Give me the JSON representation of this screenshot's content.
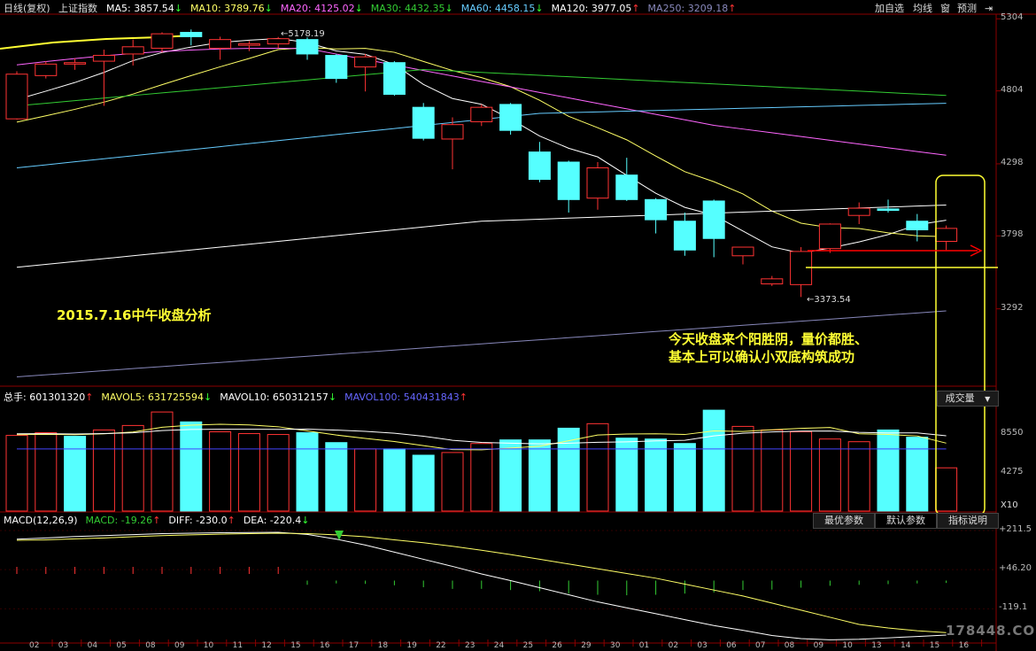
{
  "header": {
    "period": "日线(复权)",
    "index_name": "上证指数",
    "ma": [
      {
        "label": "MA5: 3857.54",
        "arrow": "↓",
        "color": "#ffffff"
      },
      {
        "label": "MA10: 3789.76",
        "arrow": "↓",
        "color": "#ffff66"
      },
      {
        "label": "MA20: 4125.02",
        "arrow": "↓",
        "color": "#ff66ff"
      },
      {
        "label": "MA30: 4432.35",
        "arrow": "↓",
        "color": "#33cc33"
      },
      {
        "label": "MA60: 4458.15",
        "arrow": "↓",
        "color": "#66ccff"
      },
      {
        "label": "MA120: 3977.05",
        "arrow": "↑",
        "color": "#ffffff"
      },
      {
        "label": "MA250: 3209.18",
        "arrow": "↑",
        "color": "#8888bb"
      }
    ],
    "buttons": [
      "加自选",
      "均线",
      "窗",
      "预测"
    ],
    "collapse_icon": "collapse-right-icon"
  },
  "volume_header": {
    "items": [
      {
        "label": "总手: 601301320",
        "arrow": "↑",
        "color": "#ffffff"
      },
      {
        "label": "MAVOL5: 631725594",
        "arrow": "↓",
        "color": "#ffff66"
      },
      {
        "label": "MAVOL10: 650312157",
        "arrow": "↓",
        "color": "#ffffff"
      },
      {
        "label": "MAVOL100: 540431843",
        "arrow": "↑",
        "color": "#6666ff"
      }
    ],
    "select_label": "成交量"
  },
  "macd_header": {
    "items": [
      {
        "label": "MACD(12,26,9)",
        "arrow": "",
        "color": "#ffffff"
      },
      {
        "label": "MACD: -19.26",
        "arrow": "↑",
        "color": "#33cc33"
      },
      {
        "label": "DIFF: -230.0",
        "arrow": "↑",
        "color": "#ffffff"
      },
      {
        "label": "DEA: -220.4",
        "arrow": "↓",
        "color": "#ffffff"
      }
    ],
    "tabs": [
      "最优参数",
      "默认参数",
      "指标说明"
    ]
  },
  "annotations": {
    "date_title": "2015.7.16中午收盘分析",
    "comment_line1": "今天收盘来个阳胜阴，量价都胜、",
    "comment_line2": "基本上可以确认小双底构筑成功",
    "high_label": "←5178.19",
    "low_label": "←3373.54",
    "volume_unit": "X10",
    "watermark": "178448.COM"
  },
  "colors": {
    "up": "#ff3333",
    "down": "#55ffff",
    "highlight": "#ffff33",
    "arrow": "#ff0000"
  },
  "chart_data": {
    "type": "candlestick",
    "title": "上证指数 日线(复权)",
    "price_axis_ticks": [
      5304,
      4804,
      4298,
      3798,
      3292
    ],
    "price_range": [
      2780,
      5330
    ],
    "x_ticks": [
      "02",
      "03",
      "04",
      "05",
      "08",
      "09",
      "10",
      "11",
      "12",
      "15",
      "16",
      "17",
      "18",
      "19",
      "22",
      "23",
      "24",
      "25",
      "26",
      "29",
      "30",
      "01",
      "02",
      "03",
      "06",
      "07",
      "08",
      "09",
      "10",
      "13",
      "14",
      "15",
      "16"
    ],
    "candles": [
      {
        "o": 4610,
        "c": 4920,
        "h": 4940,
        "l": 4605
      },
      {
        "o": 4910,
        "c": 4990,
        "h": 5010,
        "l": 4890
      },
      {
        "o": 4990,
        "c": 5000,
        "h": 5030,
        "l": 4950
      },
      {
        "o": 5010,
        "c": 5050,
        "h": 5090,
        "l": 4700
      },
      {
        "o": 5060,
        "c": 5110,
        "h": 5160,
        "l": 4980
      },
      {
        "o": 5100,
        "c": 5200,
        "h": 5210,
        "l": 5070
      },
      {
        "o": 5210,
        "c": 5180,
        "h": 5230,
        "l": 5120
      },
      {
        "o": 5100,
        "c": 5160,
        "h": 5180,
        "l": 5020
      },
      {
        "o": 5120,
        "c": 5130,
        "h": 5150,
        "l": 5080
      },
      {
        "o": 5130,
        "c": 5166,
        "h": 5178,
        "l": 5100
      },
      {
        "o": 5160,
        "c": 5060,
        "h": 5176,
        "l": 5020
      },
      {
        "o": 5050,
        "c": 4890,
        "h": 5060,
        "l": 4860
      },
      {
        "o": 4970,
        "c": 5040,
        "h": 5060,
        "l": 4800
      },
      {
        "o": 5000,
        "c": 4780,
        "h": 5010,
        "l": 4770
      },
      {
        "o": 4690,
        "c": 4475,
        "h": 4720,
        "l": 4460
      },
      {
        "o": 4470,
        "c": 4570,
        "h": 4620,
        "l": 4260
      },
      {
        "o": 4590,
        "c": 4690,
        "h": 4710,
        "l": 4560
      },
      {
        "o": 4710,
        "c": 4530,
        "h": 4720,
        "l": 4500
      },
      {
        "o": 4380,
        "c": 4190,
        "h": 4450,
        "l": 4170
      },
      {
        "o": 4310,
        "c": 4050,
        "h": 4320,
        "l": 3960
      },
      {
        "o": 4060,
        "c": 4270,
        "h": 4310,
        "l": 3980
      },
      {
        "o": 4220,
        "c": 4050,
        "h": 4340,
        "l": 4040
      },
      {
        "o": 4050,
        "c": 3910,
        "h": 4060,
        "l": 3815
      },
      {
        "o": 3900,
        "c": 3700,
        "h": 3960,
        "l": 3660
      },
      {
        "o": 4040,
        "c": 3780,
        "h": 4050,
        "l": 3650
      },
      {
        "o": 3660,
        "c": 3720,
        "h": 3720,
        "l": 3600
      },
      {
        "o": 3465,
        "c": 3500,
        "h": 3520,
        "l": 3450
      },
      {
        "o": 3460,
        "c": 3690,
        "h": 3720,
        "l": 3374
      },
      {
        "o": 3710,
        "c": 3880,
        "h": 3885,
        "l": 3680
      },
      {
        "o": 3940,
        "c": 3990,
        "h": 4030,
        "l": 3880
      },
      {
        "o": 3985,
        "c": 3975,
        "h": 4050,
        "l": 3960
      },
      {
        "o": 3900,
        "c": 3840,
        "h": 3950,
        "l": 3760
      },
      {
        "o": 3760,
        "c": 3850,
        "h": 3870,
        "l": 3700
      }
    ],
    "volume_axis_ticks": [
      8550,
      4275
    ],
    "volume": [
      {
        "v": 8400,
        "up": true
      },
      {
        "v": 8700,
        "up": true
      },
      {
        "v": 8300,
        "up": false
      },
      {
        "v": 9000,
        "up": true
      },
      {
        "v": 9500,
        "up": true
      },
      {
        "v": 11000,
        "up": true
      },
      {
        "v": 9900,
        "up": false
      },
      {
        "v": 8800,
        "up": true
      },
      {
        "v": 8600,
        "up": true
      },
      {
        "v": 8500,
        "up": true
      },
      {
        "v": 8700,
        "up": false
      },
      {
        "v": 7600,
        "up": false
      },
      {
        "v": 6900,
        "up": true
      },
      {
        "v": 6900,
        "up": false
      },
      {
        "v": 6200,
        "up": false
      },
      {
        "v": 6500,
        "up": true
      },
      {
        "v": 7500,
        "up": true
      },
      {
        "v": 7900,
        "up": false
      },
      {
        "v": 7900,
        "up": false
      },
      {
        "v": 9200,
        "up": false
      },
      {
        "v": 9700,
        "up": true
      },
      {
        "v": 8100,
        "up": false
      },
      {
        "v": 8000,
        "up": false
      },
      {
        "v": 7500,
        "up": false
      },
      {
        "v": 11200,
        "up": false
      },
      {
        "v": 9400,
        "up": true
      },
      {
        "v": 9000,
        "up": true
      },
      {
        "v": 8800,
        "up": true
      },
      {
        "v": 8000,
        "up": true
      },
      {
        "v": 7700,
        "up": true
      },
      {
        "v": 9000,
        "up": false
      },
      {
        "v": 8200,
        "up": false
      },
      {
        "v": 4800,
        "up": true
      }
    ],
    "macd_axis_ticks": [
      "+211.5",
      "+46.20",
      "-119.1"
    ],
    "macd_range": [
      -260,
      230
    ],
    "macd_hist": [
      0,
      0,
      0,
      0,
      0,
      0,
      0,
      0,
      0,
      0,
      -18,
      -12,
      -14,
      -20,
      -28,
      -35,
      -35,
      -40,
      -45,
      -55,
      -60,
      -62,
      -60,
      -55,
      -50,
      -40,
      -38,
      -30,
      -22,
      -18,
      -15,
      -12,
      -10
    ],
    "diff": [
      175,
      180,
      186,
      190,
      194,
      198,
      200,
      202,
      203,
      204,
      195,
      175,
      150,
      120,
      90,
      60,
      28,
      0,
      -30,
      -60,
      -90,
      -115,
      -140,
      -165,
      -190,
      -210,
      -232,
      -245,
      -250,
      -248,
      -242,
      -236,
      -230
    ],
    "dea": [
      170,
      172,
      176,
      180,
      185,
      190,
      193,
      196,
      198,
      200,
      198,
      193,
      185,
      172,
      160,
      145,
      128,
      110,
      90,
      70,
      50,
      30,
      10,
      -15,
      -40,
      -65,
      -95,
      -125,
      -155,
      -185,
      -200,
      -212,
      -220
    ]
  }
}
